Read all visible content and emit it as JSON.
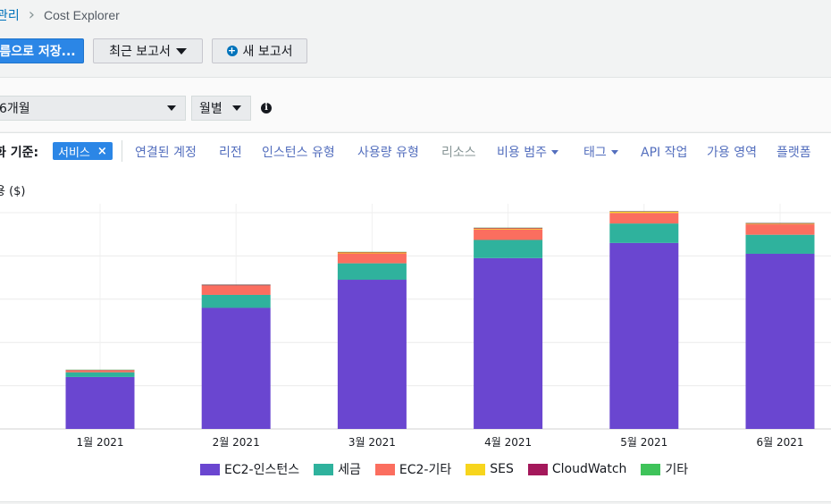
{
  "breadcrumb": {
    "parent": "관리",
    "current": "Cost Explorer"
  },
  "toolbar": {
    "save_label": "름으로 저장...",
    "recent_label": "최근 보고서",
    "new_label": "새 보고서"
  },
  "filters": {
    "range_label": "6개월",
    "granularity_label": "월별"
  },
  "group_by": {
    "label": "화 기준:",
    "chip": "서비스",
    "options": [
      "연결된 계정",
      "리전",
      "인스턴스 유형",
      "사용량 유형",
      "리소스",
      "비용 범주",
      "태그",
      "API 작업",
      "가용 영역",
      "플랫폼"
    ]
  },
  "colors": {
    "accent": "#2b86e6",
    "ec2": "#6a46d0",
    "tax": "#2fb29d",
    "ec2other": "#fb6e5f",
    "ses": "#f7d51d",
    "cloudwatch": "#a4185b",
    "other": "#3fc35a"
  },
  "chart_data": {
    "type": "bar",
    "stacked": true,
    "ylabel": "용 ($)",
    "categories": [
      "1월 2021",
      "2월 2021",
      "3월 2021",
      "4월 2021",
      "5월 2021",
      "6월 2021"
    ],
    "series": [
      {
        "name": "EC2-인스턴스",
        "values": [
          0.24,
          0.56,
          0.69,
          0.79,
          0.86,
          0.81
        ]
      },
      {
        "name": "세금",
        "values": [
          0.022,
          0.06,
          0.076,
          0.084,
          0.09,
          0.088
        ]
      },
      {
        "name": "EC2-기타",
        "values": [
          0.008,
          0.042,
          0.046,
          0.049,
          0.049,
          0.048
        ]
      },
      {
        "name": "SES",
        "values": [
          0.001,
          0.001,
          0.004,
          0.004,
          0.005,
          0.003
        ]
      },
      {
        "name": "CloudWatch",
        "values": [
          0.002,
          0.004,
          0.002,
          0.003,
          0.002,
          0.003
        ]
      },
      {
        "name": "기타",
        "values": [
          0.001,
          0.001,
          0.001,
          0.001,
          0.001,
          0.001
        ]
      }
    ],
    "ylim": [
      0,
      1
    ],
    "grid": true,
    "legend": "bottom"
  }
}
